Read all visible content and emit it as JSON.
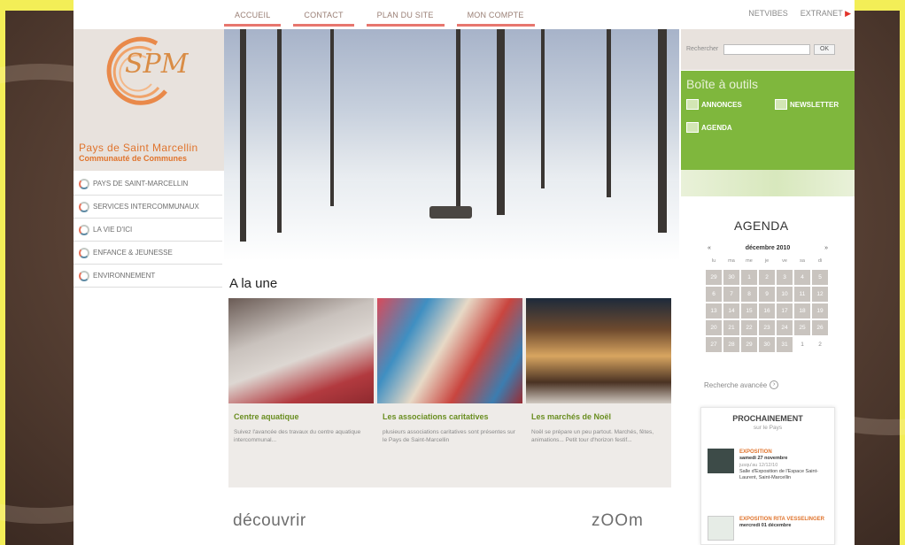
{
  "nav": {
    "items": [
      "ACCUEIL",
      "CONTACT",
      "PLAN DU SITE",
      "MON COMPTE"
    ],
    "netvibes": "NETVIBES",
    "extranet": "EXTRANET"
  },
  "logo": {
    "initials": "SPM",
    "title": "Pays de Saint Marcellin",
    "subtitle": "Communauté de Communes"
  },
  "sidebar": {
    "items": [
      {
        "label": "PAYS DE SAINT-MARCELLIN"
      },
      {
        "label": "SERVICES INTERCOMMUNAUX"
      },
      {
        "label": "LA VIE D'ICI"
      },
      {
        "label": "ENFANCE & JEUNESSE"
      },
      {
        "label": "ENVIRONNEMENT"
      }
    ]
  },
  "search": {
    "label": "Rechercher",
    "value": "",
    "button": "OK"
  },
  "toolbox": {
    "title": "Boîte à outils",
    "items": [
      "ANNONCES",
      "NEWSLETTER",
      "AGENDA"
    ]
  },
  "une": {
    "title": "A la une",
    "cards": [
      {
        "title": "Centre aquatique",
        "text": "Suivez l'avancée des travaux du centre aquatique intercommunal..."
      },
      {
        "title": "Les associations caritatives",
        "text": "plusieurs associations caritatives sont présentes sur le Pays de Saint-Marcellin"
      },
      {
        "title": "Les marchés de Noël",
        "text": "Noël se prépare un peu partout. Marchés, fêtes, animations... Petit tour d'horizon festif..."
      }
    ]
  },
  "bottom": {
    "decouvrir": "découvrir",
    "zoom": "zOOm"
  },
  "agenda": {
    "title": "AGENDA",
    "prev": "«",
    "month": "décembre 2010",
    "next": "»",
    "dows": [
      "lu",
      "ma",
      "me",
      "je",
      "ve",
      "sa",
      "di"
    ],
    "days": [
      "29",
      "30",
      "1",
      "2",
      "3",
      "4",
      "5",
      "6",
      "7",
      "8",
      "9",
      "10",
      "11",
      "12",
      "13",
      "14",
      "15",
      "16",
      "17",
      "18",
      "19",
      "20",
      "21",
      "22",
      "23",
      "24",
      "25",
      "26",
      "27",
      "28",
      "29",
      "30",
      "31",
      "1",
      "2"
    ],
    "advanced": "Recherche avancée"
  },
  "prochainement": {
    "title": "PROCHAINEMENT",
    "subtitle": "sur le Pays",
    "events": [
      {
        "type": "EXPOSITION",
        "date": "samedi 27 novembre",
        "until": "jusqu'au 12/12/10",
        "place": "Salle d'Exposition de l'Espace Saint-Laurent, Saint-Marcellin"
      },
      {
        "type": "EXPOSITION RITA VESSELINGER",
        "date": "mercredi 01 décembre"
      }
    ]
  },
  "colors": {
    "accent": "#7fb73d",
    "nav_underline": "#e7766e",
    "orange": "#e0742d",
    "page_bg": "#f3ee57"
  }
}
